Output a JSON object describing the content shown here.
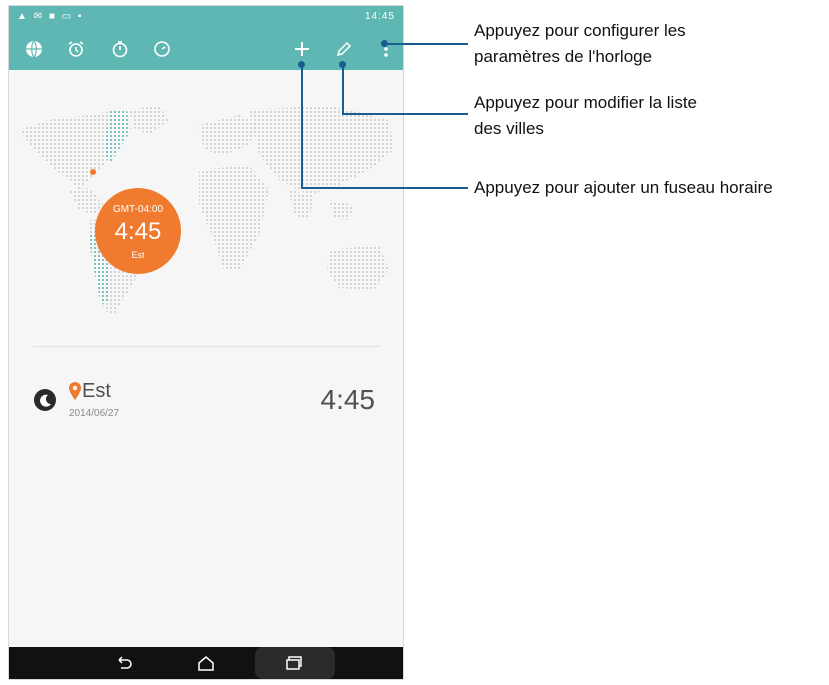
{
  "statusbar": {
    "left_icons": "▲ ✉ ■ ▭ ▪",
    "time": "14:45"
  },
  "toolbar": {
    "tabs": [
      "world-clock",
      "alarm",
      "stopwatch",
      "timer"
    ],
    "actions": [
      "add",
      "edit",
      "more"
    ]
  },
  "map": {
    "bubble": {
      "gmt": "GMT-04:00",
      "time": "4:45",
      "city": "Est"
    },
    "accent": "#f07a2d",
    "dots_color": "#c9c9c9",
    "highlight_color": "#5fb7b4"
  },
  "clock_list": [
    {
      "city": "Est",
      "date": "2014/06/27",
      "time": "4:45"
    }
  ],
  "callouts": {
    "settings_line1": "Appuyez pour configurer les",
    "settings_line2": "paramètres de l'horloge",
    "edit_line1": "Appuyez pour modifier la liste",
    "edit_line2": "des villes",
    "add": "Appuyez pour ajouter un fuseau horaire"
  },
  "colors": {
    "toolbar": "#5fb7b4",
    "callout": "#1a5e8f"
  }
}
